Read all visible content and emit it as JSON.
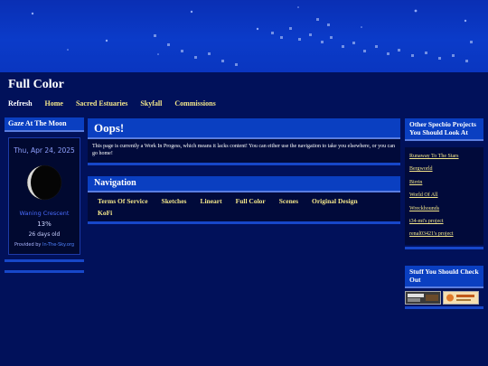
{
  "header": {
    "site_title": "Full Color",
    "nav": [
      "Refresh",
      "Home",
      "Sacred Estuaries",
      "Skyfall",
      "Commissions"
    ]
  },
  "moon_widget": {
    "title": "Gaze At The Moon",
    "date": "Thu, Apr 24, 2025",
    "phase": "Waning Crescent",
    "illumination": "13%",
    "age": "26 days old",
    "credit_prefix": "Provided by",
    "credit_link": "In-The-Sky.org"
  },
  "main": {
    "oops_title": "Oops!",
    "oops_text": "This page is currently a Work In Progess, which means it lacks content! You can either use the navigation to take you elsewhere, or you can go home!",
    "navigation_title": "Navigation",
    "navigation_links": [
      "Terms Of Service",
      "Sketches",
      "Lineart",
      "Full Color",
      "Scenes",
      "Original Design",
      "KoFi"
    ]
  },
  "sidebar": {
    "projects_title": "Other Specbio Projects You Should Look At",
    "projects": [
      "Runaway To The Stars",
      "Bergworld",
      "Birrin",
      "World Of All",
      "Wreckhounds",
      "t34-mt's project",
      "renal03421's project"
    ],
    "stuff_title": "Stuff You Should Check Out"
  },
  "colors": {
    "page_bg": "#01115a",
    "panel_header": "#0a3fc1",
    "link_yellow": "#f3e68a"
  }
}
